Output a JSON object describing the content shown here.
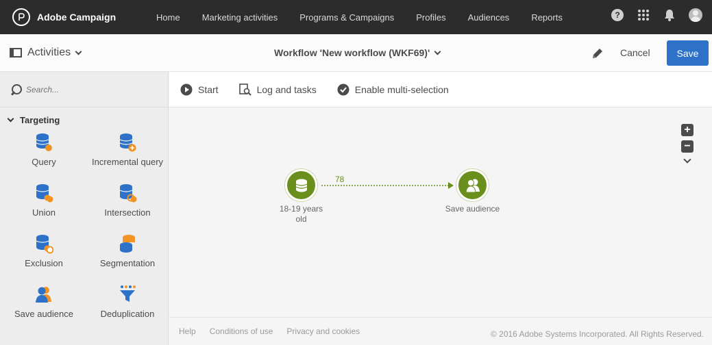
{
  "topbar": {
    "brand": "Adobe Campaign",
    "nav": [
      "Home",
      "Marketing activities",
      "Programs & Campaigns",
      "Profiles",
      "Audiences",
      "Reports"
    ],
    "icons": [
      "help-icon",
      "apps-grid-icon",
      "bell-icon",
      "avatar-icon"
    ]
  },
  "subbar": {
    "activities_label": "Activities",
    "workflow_title": "Workflow 'New workflow (WKF69)'",
    "cancel_label": "Cancel",
    "save_label": "Save"
  },
  "sidebar": {
    "search_placeholder": "Search...",
    "section": "Targeting",
    "activities": [
      {
        "label": "Query",
        "icon": "query-icon"
      },
      {
        "label": "Incremental query",
        "icon": "incremental-query-icon"
      },
      {
        "label": "Union",
        "icon": "union-icon"
      },
      {
        "label": "Intersection",
        "icon": "intersection-icon"
      },
      {
        "label": "Exclusion",
        "icon": "exclusion-icon"
      },
      {
        "label": "Segmentation",
        "icon": "segmentation-icon"
      },
      {
        "label": "Save audience",
        "icon": "save-audience-icon"
      },
      {
        "label": "Deduplication",
        "icon": "deduplication-icon"
      }
    ]
  },
  "toolbar": {
    "start_label": "Start",
    "log_label": "Log and tasks",
    "multi_label": "Enable multi-selection"
  },
  "canvas": {
    "zoom_in": "+",
    "zoom_out": "−",
    "nodes": [
      {
        "label": "18-19 years old",
        "icon": "query-icon"
      },
      {
        "label": "Save audience",
        "icon": "save-audience-icon"
      }
    ],
    "transition_count": "78"
  },
  "footer": {
    "links": [
      "Help",
      "Conditions of use",
      "Privacy and cookies"
    ],
    "copyright": "© 2016 Adobe Systems Incorporated. All Rights Reserved."
  },
  "colors": {
    "topbar": "#2c2c2c",
    "primary_button": "#2d72c8",
    "node_green": "#6a8f1c",
    "icon_blue": "#2d72c8",
    "icon_orange": "#f29423"
  }
}
